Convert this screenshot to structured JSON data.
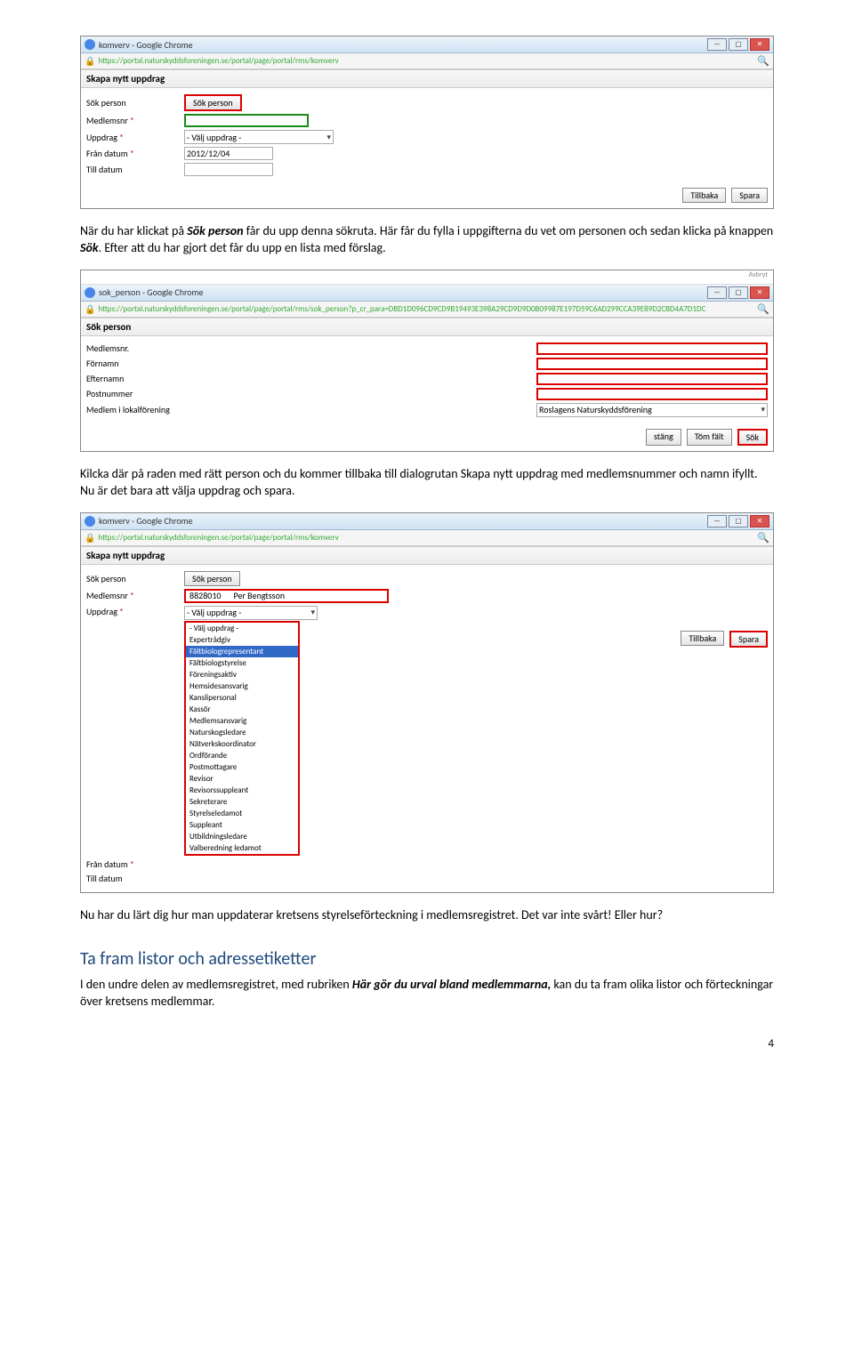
{
  "screenshot1": {
    "tab_title": "komverv - Google Chrome",
    "url": "https://portal.naturskyddsforeningen.se/portal/page/portal/rms/komverv",
    "section_title": "Skapa nytt uppdrag",
    "labels": {
      "sok_person": "Sök person",
      "medlemsnr": "Medlemsnr",
      "uppdrag": "Uppdrag",
      "fran_datum": "Från datum",
      "till_datum": "Till datum"
    },
    "sok_button": "Sök person",
    "uppdrag_select": "- Välj uppdrag -",
    "fran_datum_value": "2012/12/04",
    "buttons": {
      "tillbaka": "Tillbaka",
      "spara": "Spara"
    }
  },
  "para1": {
    "t1": "När du har klickat på ",
    "b1": "Sök person",
    "t2": " får du upp denna sökruta. Här får du fylla i uppgifterna du vet om personen och sedan klicka på knappen ",
    "b2": "Sök",
    "t3": ". Efter att du har gjort det får du upp en lista med förslag."
  },
  "screenshot2": {
    "tab_title": "sok_person - Google Chrome",
    "url": "https://portal.naturskyddsforeningen.se/portal/page/portal/rms/sok_person?p_cr_para=DBD1D096CD9CD9B19493E398A29CD9D9D0B09987E197D59C6AD299CCA39E89D2CBD4A7D1DC",
    "section_title": "Sök person",
    "labels": {
      "medlemsnr": "Medlemsnr.",
      "fornamn": "Förnamn",
      "efternamn": "Efternamn",
      "postnummer": "Postnummer",
      "medlem_i": "Medlem i lokalförening"
    },
    "forening_value": "Roslagens Naturskyddsförening",
    "buttons": {
      "stang": "stäng",
      "tom_falt": "Töm fält",
      "sok": "Sök"
    },
    "top_note": "Avbryt"
  },
  "para2": "Kilcka där på raden med rätt person och du kommer tillbaka till dialogrutan Skapa nytt uppdrag med medlemsnummer och namn ifyllt. Nu är det bara att välja uppdrag och spara.",
  "screenshot3": {
    "tab_title": "komverv - Google Chrome",
    "url": "https://portal.naturskyddsforeningen.se/portal/page/portal/rms/komverv",
    "section_title": "Skapa nytt uppdrag",
    "labels": {
      "sok_person": "Sök person",
      "medlemsnr": "Medlemsnr",
      "uppdrag": "Uppdrag",
      "fran_datum": "Från datum",
      "till_datum": "Till datum"
    },
    "sok_button": "Sök person",
    "member_number": "8828010",
    "member_name": "Per Bengtsson",
    "uppdrag_selected": "- Välj uppdrag -",
    "uppdrag_options": [
      "- Välj uppdrag -",
      "Expertrådgiv",
      "Fältbiologrepresentant",
      "Fältbiologstyrelse",
      "Föreningsaktiv",
      "Hemsidesansvarig",
      "Kanslipersonal",
      "Kassör",
      "Medlemsansvarig",
      "Naturskogsledare",
      "Nätverkskoordinator",
      "Ordförande",
      "Postmottagare",
      "Revisor",
      "Revisorssuppleant",
      "Sekreterare",
      "Styrelseledamot",
      "Suppleant",
      "Utbildningsledare",
      "Valberedning ledamot"
    ],
    "buttons": {
      "tillbaka": "Tillbaka",
      "spara": "Spara"
    }
  },
  "para3": "Nu har du lärt dig hur man uppdaterar kretsens styrelseförteckning i medlemsregistret. Det var inte svårt! Eller hur?",
  "heading2": "Ta fram listor och adressetiketter",
  "para4": {
    "t1": "I den undre delen av medlemsregistret, med rubriken ",
    "b1": "Här gör du urval bland medlemmarna,",
    "t2": " kan du ta fram olika listor och förteckningar över kretsens medlemmar."
  },
  "page_number": "4"
}
